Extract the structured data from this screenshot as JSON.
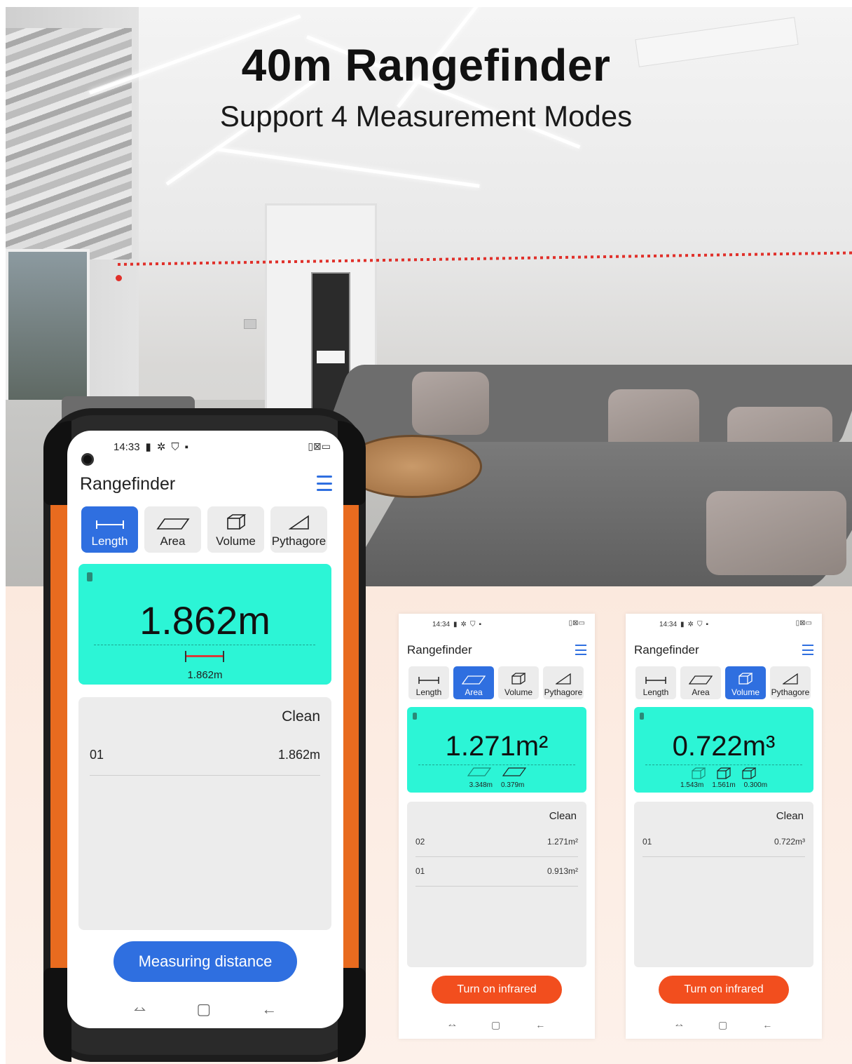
{
  "hero": {
    "title": "40m Rangefinder",
    "subtitle": "Support 4 Measurement Modes"
  },
  "colors": {
    "accent_blue": "#2f6fe0",
    "result_cyan": "#2cf5d6",
    "infrared_orange": "#f24e1e",
    "phone_orange": "#e86b1f",
    "laser_red": "#e0302a"
  },
  "main_phone": {
    "status_time": "14:33",
    "status_icons": [
      "battery-icon",
      "gear-icon",
      "shield-icon",
      "sim-icon"
    ],
    "status_right": "▯⊠▭",
    "app_title": "Rangefinder",
    "modes": [
      {
        "label": "Length",
        "icon": "length-icon",
        "active": true
      },
      {
        "label": "Area",
        "icon": "area-icon",
        "active": false
      },
      {
        "label": "Volume",
        "icon": "volume-icon",
        "active": false
      },
      {
        "label": "Pythagore",
        "icon": "pythagore-icon",
        "active": false
      }
    ],
    "result_value": "1.862m",
    "result_sub": "1.862m",
    "clean_label": "Clean",
    "log": [
      {
        "index": "01",
        "value": "1.862m"
      }
    ],
    "primary_button": "Measuring distance",
    "nav": [
      "⥎",
      "▢",
      "←"
    ]
  },
  "area_phone": {
    "status_time": "14:34",
    "status_right": "▯⊠▭",
    "app_title": "Rangefinder",
    "modes": [
      {
        "label": "Length",
        "active": false
      },
      {
        "label": "Area",
        "active": true
      },
      {
        "label": "Volume",
        "active": false
      },
      {
        "label": "Pythagore",
        "active": false
      }
    ],
    "result_value": "1.271m²",
    "result_subs": [
      "3.348m",
      "0.379m"
    ],
    "clean_label": "Clean",
    "log": [
      {
        "index": "02",
        "value": "1.271m²"
      },
      {
        "index": "01",
        "value": "0.913m²"
      }
    ],
    "button": "Turn on infrared",
    "nav": [
      "⥎",
      "▢",
      "←"
    ]
  },
  "volume_phone": {
    "status_time": "14:34",
    "status_right": "▯⊠▭",
    "app_title": "Rangefinder",
    "modes": [
      {
        "label": "Length",
        "active": false
      },
      {
        "label": "Area",
        "active": false
      },
      {
        "label": "Volume",
        "active": true
      },
      {
        "label": "Pythagore",
        "active": false
      }
    ],
    "result_value": "0.722m³",
    "result_subs": [
      "1.543m",
      "1.561m",
      "0.300m"
    ],
    "clean_label": "Clean",
    "log": [
      {
        "index": "01",
        "value": "0.722m³"
      }
    ],
    "button": "Turn on infrared",
    "nav": [
      "⥎",
      "▢",
      "←"
    ]
  }
}
